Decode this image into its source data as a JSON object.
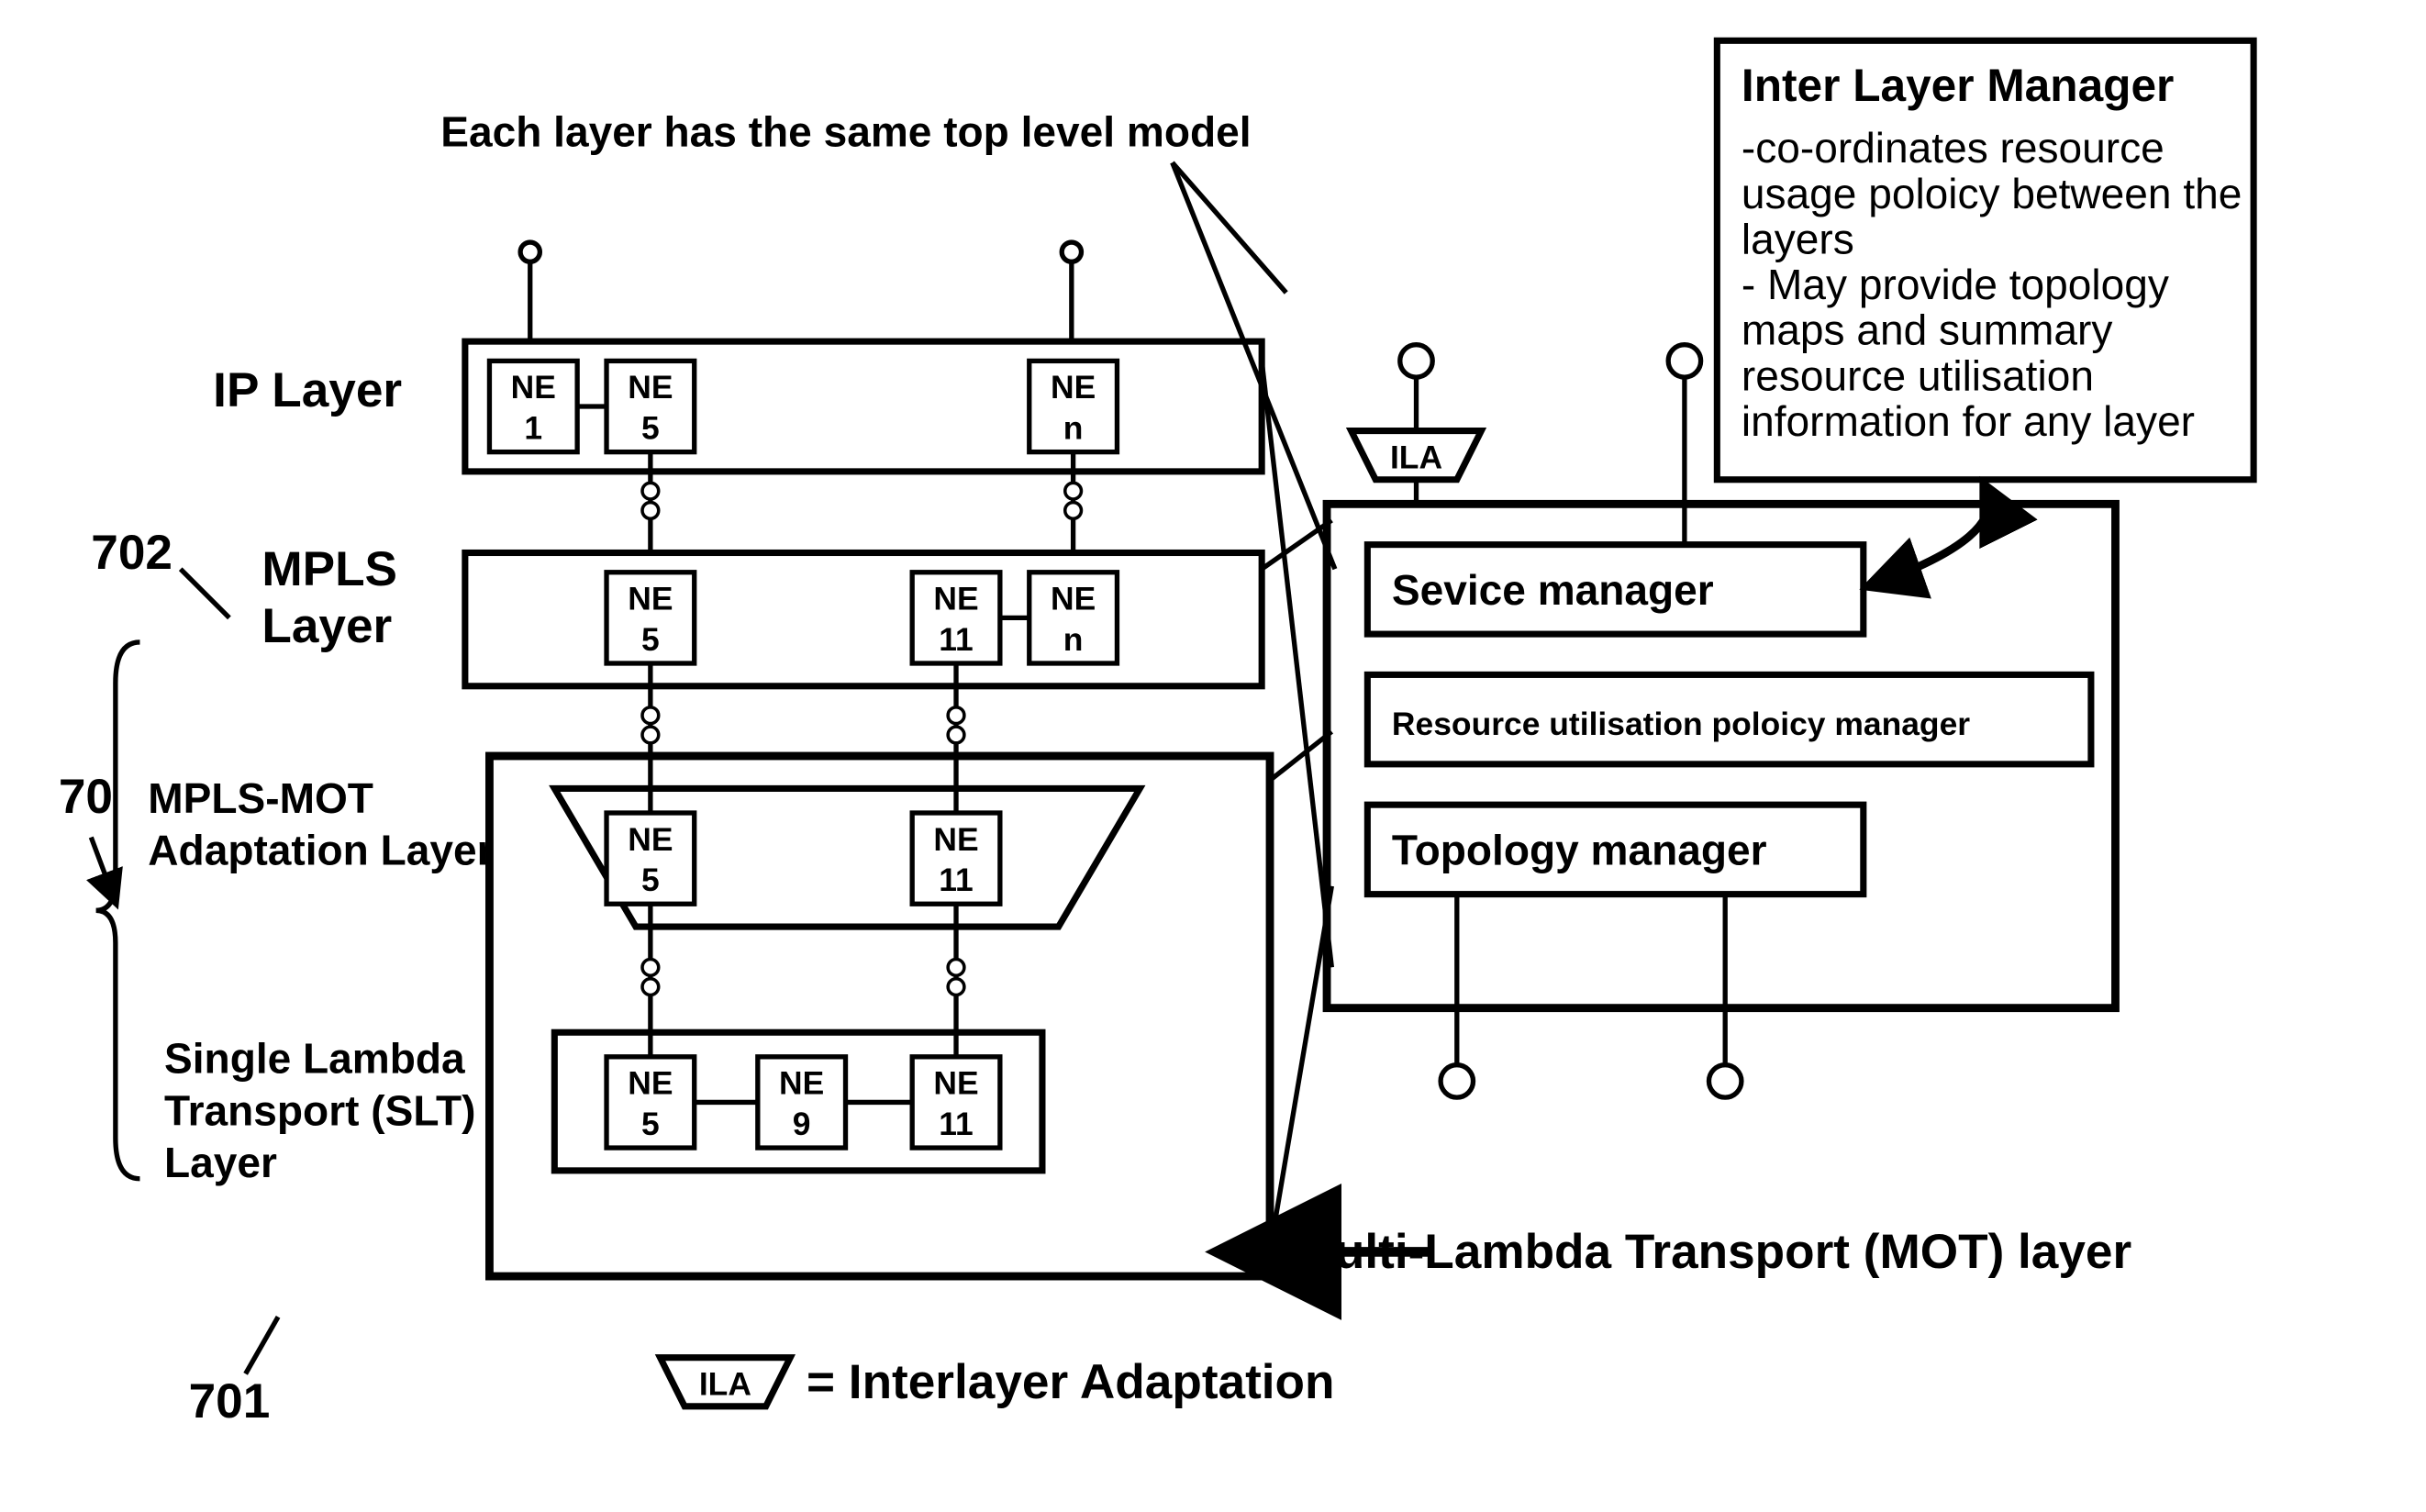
{
  "annotation": {
    "top": "Each layer has the same top level model",
    "mot": "Multi-Lambda Transport (MOT) layer",
    "ila_legend_left": "ILA",
    "ila_legend_right": "= Interlayer Adaptation",
    "ila_top": "ILA"
  },
  "ref_numbers": {
    "group": "70",
    "top": "702",
    "bottom": "701"
  },
  "layers": {
    "ip": {
      "label": "IP Layer",
      "nodes": [
        {
          "t": "NE",
          "n": "1"
        },
        {
          "t": "NE",
          "n": "5"
        },
        {
          "t": "NE",
          "n": "n"
        }
      ]
    },
    "mpls": {
      "label_l1": "MPLS",
      "label_l2": "Layer",
      "nodes": [
        {
          "t": "NE",
          "n": "5"
        },
        {
          "t": "NE",
          "n": "11"
        },
        {
          "t": "NE",
          "n": "n"
        }
      ]
    },
    "adapt": {
      "label_l1": "MPLS-MOT",
      "label_l2": "Adaptation Layer",
      "nodes": [
        {
          "t": "NE",
          "n": "5"
        },
        {
          "t": "NE",
          "n": "11"
        }
      ]
    },
    "slt": {
      "label_l1": "Single Lambda",
      "label_l2": "Transport (SLT)",
      "label_l3": "Layer",
      "nodes": [
        {
          "t": "NE",
          "n": "5"
        },
        {
          "t": "NE",
          "n": "9"
        },
        {
          "t": "NE",
          "n": "11"
        }
      ]
    }
  },
  "ilm": {
    "title": "Inter Layer Manager",
    "b1": "-co-ordinates resource",
    "b2": "usage poloicy between the",
    "b3": "layers",
    "b4": "- May provide topology",
    "b5": "maps and summary",
    "b6": "resource utilisation",
    "b7": "information for any layer"
  },
  "managers": {
    "service": "Sevice manager",
    "resource": "Resource utilisation poloicy manager",
    "topology": "Topology manager"
  }
}
